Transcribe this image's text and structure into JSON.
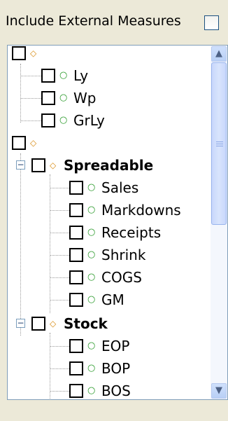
{
  "header": {
    "label": "Include External Measures"
  },
  "tree": {
    "rows": [
      {
        "label": "",
        "icon": "diamond-icon"
      },
      {
        "label": "Ly",
        "icon": "dot-icon"
      },
      {
        "label": "Wp",
        "icon": "dot-icon"
      },
      {
        "label": "GrLy",
        "icon": "dot-icon"
      },
      {
        "label": "",
        "icon": "diamond-icon"
      },
      {
        "label": "Spreadable",
        "icon": "diamond-icon",
        "expander": "−"
      },
      {
        "label": "Sales",
        "icon": "dot-icon"
      },
      {
        "label": "Markdowns",
        "icon": "dot-icon"
      },
      {
        "label": "Receipts",
        "icon": "dot-icon"
      },
      {
        "label": "Shrink",
        "icon": "dot-icon"
      },
      {
        "label": "COGS",
        "icon": "dot-icon"
      },
      {
        "label": "GM",
        "icon": "dot-icon"
      },
      {
        "label": "Stock",
        "icon": "diamond-icon",
        "expander": "−"
      },
      {
        "label": "EOP",
        "icon": "dot-icon"
      },
      {
        "label": "BOP",
        "icon": "dot-icon"
      },
      {
        "label": "BOS",
        "icon": "dot-icon"
      }
    ]
  },
  "scrollbar": {
    "up": "▲",
    "down": "▼"
  },
  "colors": {
    "diamond": "#d88a10",
    "dot": "#2a9a2a",
    "panel_border": "#7f9db9",
    "background": "#ece9d8"
  }
}
